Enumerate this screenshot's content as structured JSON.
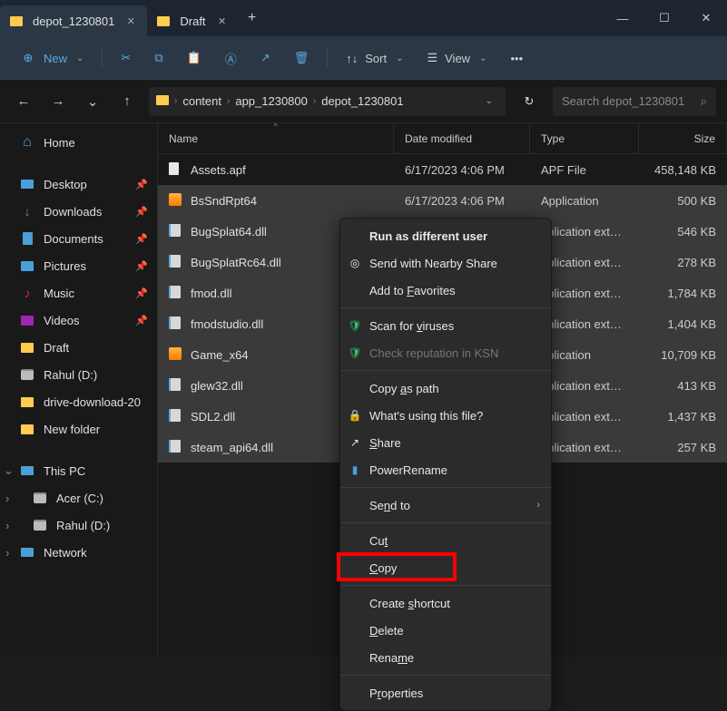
{
  "tabs": [
    {
      "title": "depot_1230801",
      "active": true
    },
    {
      "title": "Draft",
      "active": false
    }
  ],
  "toolbar": {
    "new": "New",
    "sort": "Sort",
    "view": "View"
  },
  "breadcrumb": {
    "items": [
      "content",
      "app_1230800",
      "depot_1230801"
    ]
  },
  "search": {
    "placeholder": "Search depot_1230801"
  },
  "sidebar": {
    "home": "Home",
    "pinned": [
      {
        "label": "Desktop",
        "icon": "desk-ico"
      },
      {
        "label": "Downloads",
        "icon": "dl-ico"
      },
      {
        "label": "Documents",
        "icon": "doc-ico"
      },
      {
        "label": "Pictures",
        "icon": "pic-ico"
      },
      {
        "label": "Music",
        "icon": "mus-ico"
      },
      {
        "label": "Videos",
        "icon": "vid-ico"
      }
    ],
    "folders": [
      {
        "label": "Draft",
        "icon": "folder-ico"
      },
      {
        "label": "Rahul (D:)",
        "icon": "disk-ico"
      },
      {
        "label": "drive-download-20",
        "icon": "folder-ico"
      },
      {
        "label": "New folder",
        "icon": "folder-ico"
      }
    ],
    "thispc": "This PC",
    "drives": [
      {
        "label": "Acer (C:)",
        "icon": "disk-ico"
      },
      {
        "label": "Rahul (D:)",
        "icon": "disk-ico"
      }
    ],
    "network": "Network"
  },
  "columns": {
    "name": "Name",
    "date": "Date modified",
    "type": "Type",
    "size": "Size"
  },
  "files": [
    {
      "name": "Assets.apf",
      "date": "6/17/2023 4:06 PM",
      "type": "APF File",
      "size": "458,148 KB",
      "icon": "file-ico",
      "sel": false
    },
    {
      "name": "BsSndRpt64",
      "date": "6/17/2023 4:06 PM",
      "type": "Application",
      "size": "500 KB",
      "icon": "exe-ico",
      "sel": true
    },
    {
      "name": "BugSplat64.dll",
      "date": "",
      "type": "pplication extens...",
      "size": "546 KB",
      "icon": "dll-ico",
      "sel": true
    },
    {
      "name": "BugSplatRc64.dll",
      "date": "",
      "type": "pplication extens...",
      "size": "278 KB",
      "icon": "dll-ico",
      "sel": true
    },
    {
      "name": "fmod.dll",
      "date": "",
      "type": "pplication extens...",
      "size": "1,784 KB",
      "icon": "dll-ico",
      "sel": true
    },
    {
      "name": "fmodstudio.dll",
      "date": "",
      "type": "pplication extens...",
      "size": "1,404 KB",
      "icon": "dll-ico",
      "sel": true
    },
    {
      "name": "Game_x64",
      "date": "",
      "type": "pplication",
      "size": "10,709 KB",
      "icon": "exe-ico",
      "sel": true
    },
    {
      "name": "glew32.dll",
      "date": "",
      "type": "pplication extens...",
      "size": "413 KB",
      "icon": "dll-ico",
      "sel": true
    },
    {
      "name": "SDL2.dll",
      "date": "",
      "type": "pplication extens...",
      "size": "1,437 KB",
      "icon": "dll-ico",
      "sel": true
    },
    {
      "name": "steam_api64.dll",
      "date": "",
      "type": "pplication extens...",
      "size": "257 KB",
      "icon": "dll-ico",
      "sel": true
    }
  ],
  "context_menu": {
    "items": [
      {
        "label": "Run as different user",
        "bold": true
      },
      {
        "label": "Send with Nearby Share",
        "icon": "share"
      },
      {
        "label": "Add to Favorites",
        "accel": "F"
      },
      {
        "sep": true
      },
      {
        "label": "Scan for viruses",
        "icon": "shield",
        "accel": "v"
      },
      {
        "label": "Check reputation in KSN",
        "icon": "shield",
        "disabled": true
      },
      {
        "sep": true
      },
      {
        "label": "Copy as path",
        "accel": "a"
      },
      {
        "label": "What's using this file?",
        "icon": "lock"
      },
      {
        "label": "Share",
        "icon": "share2",
        "accel": "S"
      },
      {
        "label": "PowerRename",
        "icon": "rename"
      },
      {
        "sep": true
      },
      {
        "label": "Send to",
        "sub": true,
        "accel": "n"
      },
      {
        "sep": true
      },
      {
        "label": "Cut",
        "accel": "t"
      },
      {
        "label": "Copy",
        "accel": "C",
        "highlighted": true
      },
      {
        "sep": true
      },
      {
        "label": "Create shortcut",
        "accel": "s"
      },
      {
        "label": "Delete",
        "accel": "D"
      },
      {
        "label": "Rename",
        "accel": "m"
      },
      {
        "sep": true
      },
      {
        "label": "Properties",
        "accel": "r"
      }
    ]
  }
}
